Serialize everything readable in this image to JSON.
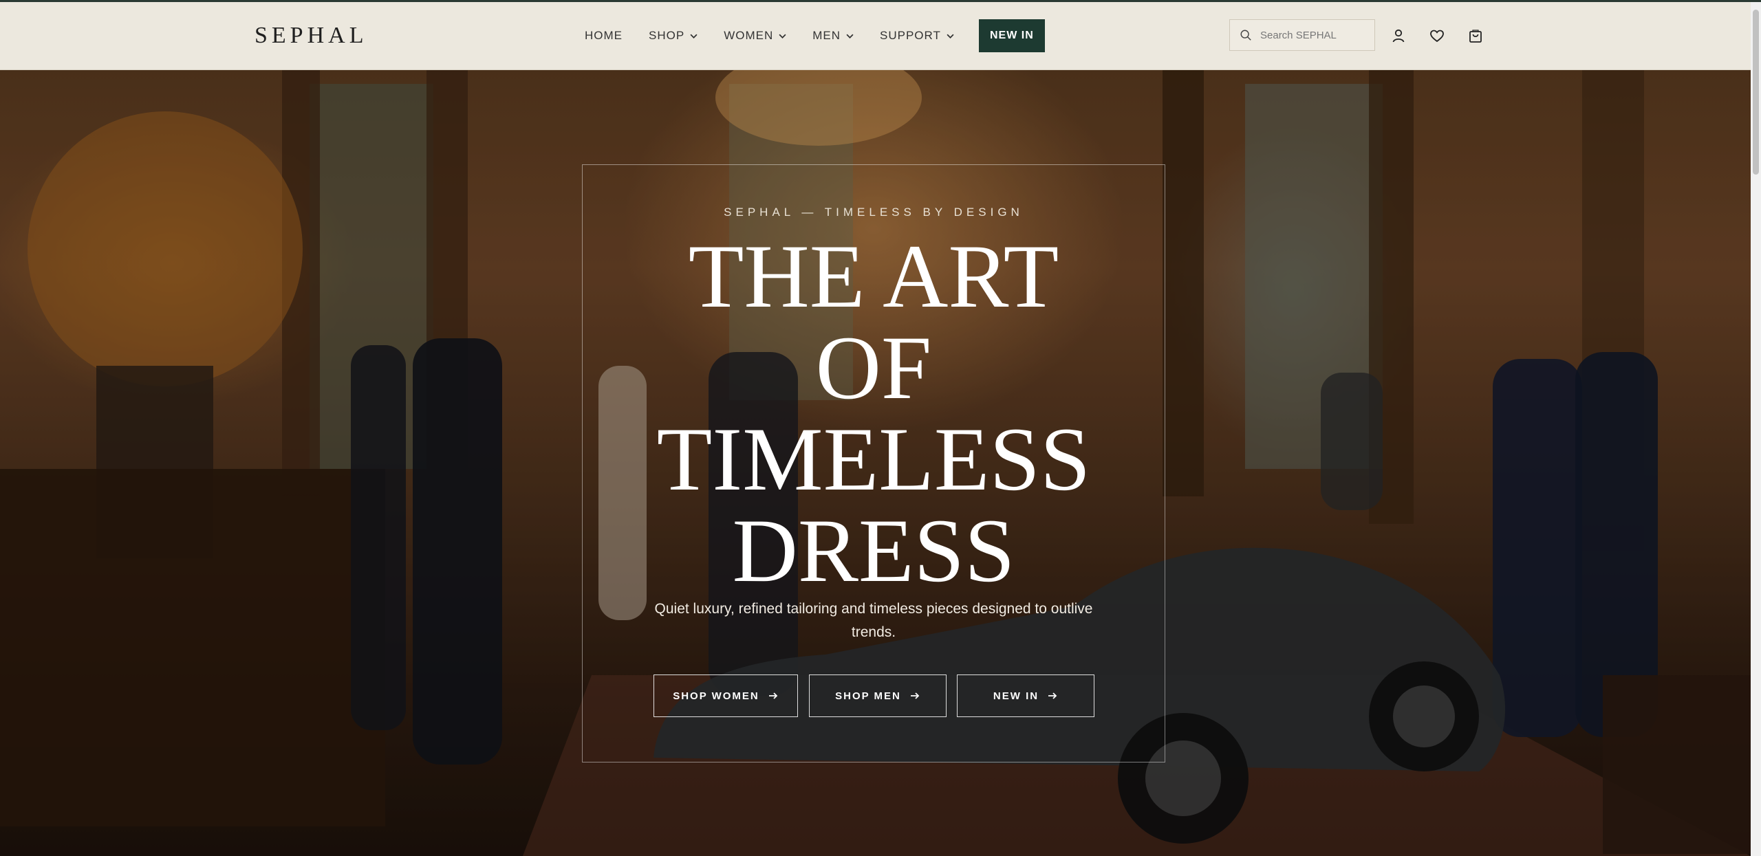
{
  "header": {
    "logo": "SEPHAL",
    "nav": [
      {
        "label": "HOME",
        "dropdown": false
      },
      {
        "label": "SHOP",
        "dropdown": true
      },
      {
        "label": "WOMEN",
        "dropdown": true
      },
      {
        "label": "MEN",
        "dropdown": true
      },
      {
        "label": "SUPPORT",
        "dropdown": true
      }
    ],
    "new_in_label": "NEW IN",
    "search_placeholder": "Search SEPHAL",
    "icons": [
      "search-icon",
      "account-icon",
      "wishlist-heart-icon",
      "shopping-bag-icon"
    ]
  },
  "hero": {
    "tagline": "SEPHAL — TIMELESS BY DESIGN",
    "headline": [
      "THE ART",
      "OF",
      "TIMELESS",
      "DRESS"
    ],
    "subtitle": "Quiet luxury, refined tailoring and timeless pieces designed to outlive trends.",
    "buttons": [
      {
        "label": "SHOP WOMEN",
        "icon": "arrow-right-icon"
      },
      {
        "label": "SHOP MEN",
        "icon": "arrow-right-icon"
      },
      {
        "label": "NEW IN",
        "icon": "arrow-right-icon"
      }
    ]
  },
  "colors": {
    "header_bg": "#ece8de",
    "accent": "#1d3a31",
    "text_dark": "#333333",
    "hero_text": "#ffffff"
  }
}
